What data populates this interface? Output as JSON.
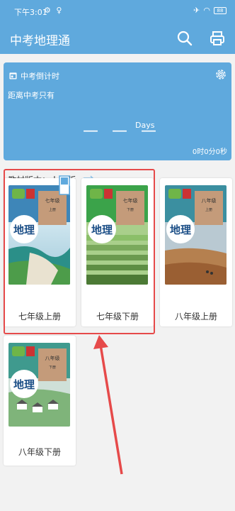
{
  "status_bar": {
    "time": "下午3:01",
    "battery": "88"
  },
  "app_bar": {
    "title": "中考地理通",
    "icons": [
      "search-icon",
      "printer-icon"
    ]
  },
  "countdown": {
    "title": "中考倒计时",
    "subtitle": "距离中考只有",
    "placeholder": "— — —",
    "unit": "Days",
    "remaining": "0时0分0秒"
  },
  "edition": {
    "label": "教材版本：人教版"
  },
  "books": [
    {
      "label": "七年级上册",
      "cover_title": "地理",
      "grade": "七年级",
      "volume": "上册"
    },
    {
      "label": "七年级下册",
      "cover_title": "地理",
      "grade": "七年级",
      "volume": "下册"
    },
    {
      "label": "八年级上册",
      "cover_title": "地理",
      "grade": "八年级",
      "volume": "上册"
    },
    {
      "label": "八年级下册",
      "cover_title": "地理",
      "grade": "八年级",
      "volume": "下册"
    }
  ],
  "colors": {
    "primary": "#5fa9dd",
    "highlight": "#e64a4a"
  }
}
